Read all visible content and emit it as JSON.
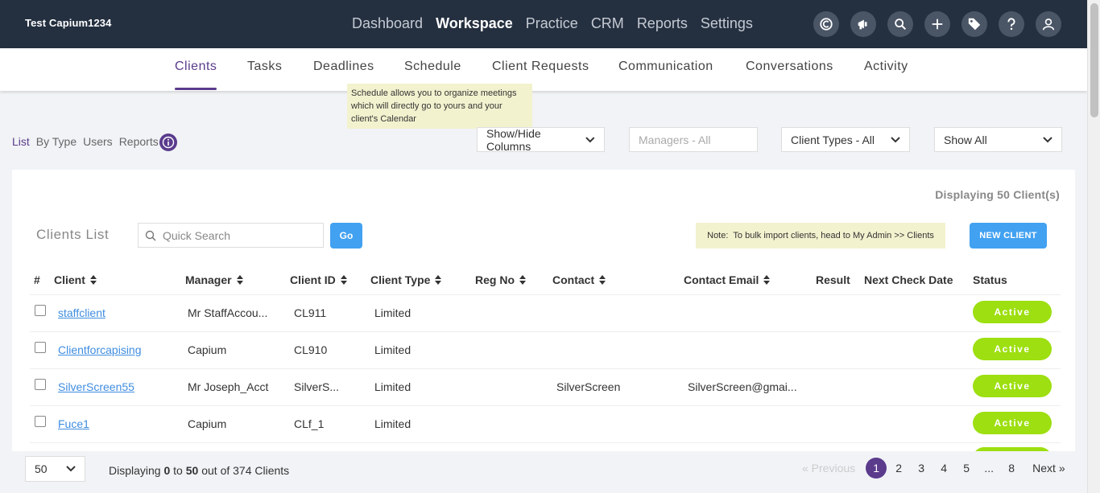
{
  "app": {
    "name": "Test Capium1234"
  },
  "topnav": [
    "Dashboard",
    "Workspace",
    "Practice",
    "CRM",
    "Reports",
    "Settings"
  ],
  "top_icons": [
    "capium-logo-icon",
    "megaphone-icon",
    "search-icon",
    "plus-icon",
    "ticket-icon",
    "help-icon",
    "user-icon"
  ],
  "subnav": [
    "Clients",
    "Tasks",
    "Deadlines",
    "Schedule",
    "Client Requests",
    "Communication",
    "Conversations",
    "Activity"
  ],
  "tooltip": {
    "line1": "Schedule allows you to organize meetings",
    "line2": "which will directly go to yours and your",
    "line3": "client's Calendar"
  },
  "view_tabs": [
    "List",
    "By Type",
    "Users",
    "Reports"
  ],
  "filters": {
    "columns": "Show/Hide Columns",
    "managers_placeholder": "Managers - All",
    "client_types": "Client Types - All",
    "show": "Show All"
  },
  "panel": {
    "displaying": "Displaying 50 Client(s)",
    "title": "Clients List",
    "search_placeholder": "Quick Search",
    "go": "Go",
    "note_label": "Note:",
    "note_text": "To bulk import clients, head to My Admin >> Clients",
    "new_client": "NEW CLIENT"
  },
  "table": {
    "headers": [
      "#",
      "Client",
      "Manager",
      "Client ID",
      "Client Type",
      "Reg No",
      "Contact",
      "Contact Email",
      "Result",
      "Next Check Date",
      "Status"
    ],
    "rows": [
      {
        "client": "staffclient",
        "manager": "Mr StaffAccou...",
        "client_id": "CL911",
        "client_type": "Limited",
        "reg_no": "",
        "contact": "",
        "email": "",
        "status": "Active"
      },
      {
        "client": "Clientforcapising",
        "manager": "Capium",
        "client_id": "CL910",
        "client_type": "Limited",
        "reg_no": "",
        "contact": "",
        "email": "",
        "status": "Active"
      },
      {
        "client": "SilverScreen55",
        "manager": "Mr Joseph_Acct",
        "client_id": "SilverS...",
        "client_type": "Limited",
        "reg_no": "",
        "contact": "SilverScreen",
        "email": "SilverScreen@gmai...",
        "status": "Active"
      },
      {
        "client": "Fuce1",
        "manager": "Capium",
        "client_id": "CLf_1",
        "client_type": "Limited",
        "reg_no": "",
        "contact": "",
        "email": "",
        "status": "Active"
      }
    ]
  },
  "footer": {
    "page_size": "50",
    "info_prefix": "Displaying",
    "from": "0",
    "to_word": "to",
    "to": "50",
    "suffix": "out of 374 Clients",
    "prev": "« Previous",
    "pages": [
      "1",
      "2",
      "3",
      "4",
      "5",
      "...",
      "8"
    ],
    "next": "Next »"
  },
  "colors": {
    "topbar": "#243040",
    "accent": "#5a3b8c",
    "button": "#42a1f1",
    "active_badge": "#9ddf10",
    "note_bg": "#f3f2cf"
  }
}
